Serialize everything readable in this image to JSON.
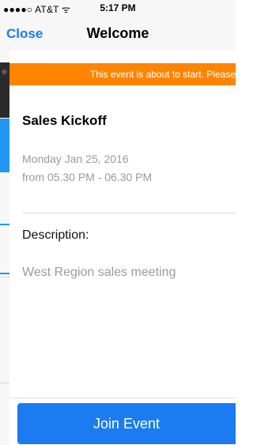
{
  "status_bar": {
    "signal_carrier": "●●●●○ AT&T ᯤ",
    "time": "5:17 PM"
  },
  "navbar": {
    "close_label": "Close",
    "title": "Welcome"
  },
  "banner": {
    "text": "This event is about to start. Please",
    "color": "#ff8500"
  },
  "event": {
    "title": "Sales Kickoff",
    "date": "Monday Jan 25, 2016",
    "time_range": "from 05.30 PM - 06.30 PM"
  },
  "description": {
    "label": "Description:",
    "text": "West Region sales meeting"
  },
  "footer": {
    "join_label": "Join Event"
  },
  "colors": {
    "accent": "#1a7cf0",
    "banner": "#ff8500"
  }
}
